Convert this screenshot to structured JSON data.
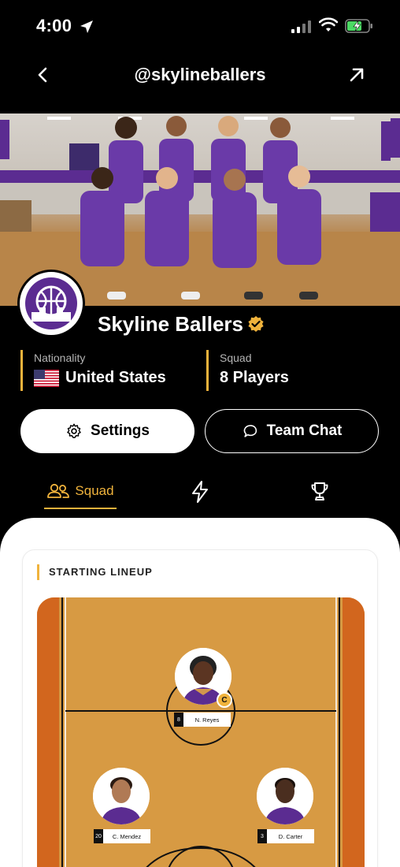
{
  "status_bar": {
    "time": "4:00"
  },
  "nav": {
    "title": "@skylineballers"
  },
  "team": {
    "name": "Skyline Ballers",
    "verified": true
  },
  "stats": {
    "nationality": {
      "label": "Nationality",
      "value": "United States"
    },
    "squad": {
      "label": "Squad",
      "value": "8 Players"
    }
  },
  "actions": {
    "settings_label": "Settings",
    "chat_label": "Team Chat"
  },
  "tabs": [
    {
      "label": "Squad",
      "icon": "users-icon",
      "active": true
    },
    {
      "label": "",
      "icon": "lightning-icon",
      "active": false
    },
    {
      "label": "",
      "icon": "trophy-icon",
      "active": false
    }
  ],
  "lineup": {
    "title": "STARTING LINEUP",
    "players": [
      {
        "number": "8",
        "name": "N. Reyes",
        "captain": true,
        "captain_badge": "C"
      },
      {
        "number": "20",
        "name": "C. Mendez",
        "captain": false
      },
      {
        "number": "3",
        "name": "D. Carter",
        "captain": false
      }
    ]
  },
  "colors": {
    "accent": "#f0b33c",
    "court": "#d79a43",
    "court_edge": "#d2661e",
    "brand_purple": "#5b2c91"
  }
}
